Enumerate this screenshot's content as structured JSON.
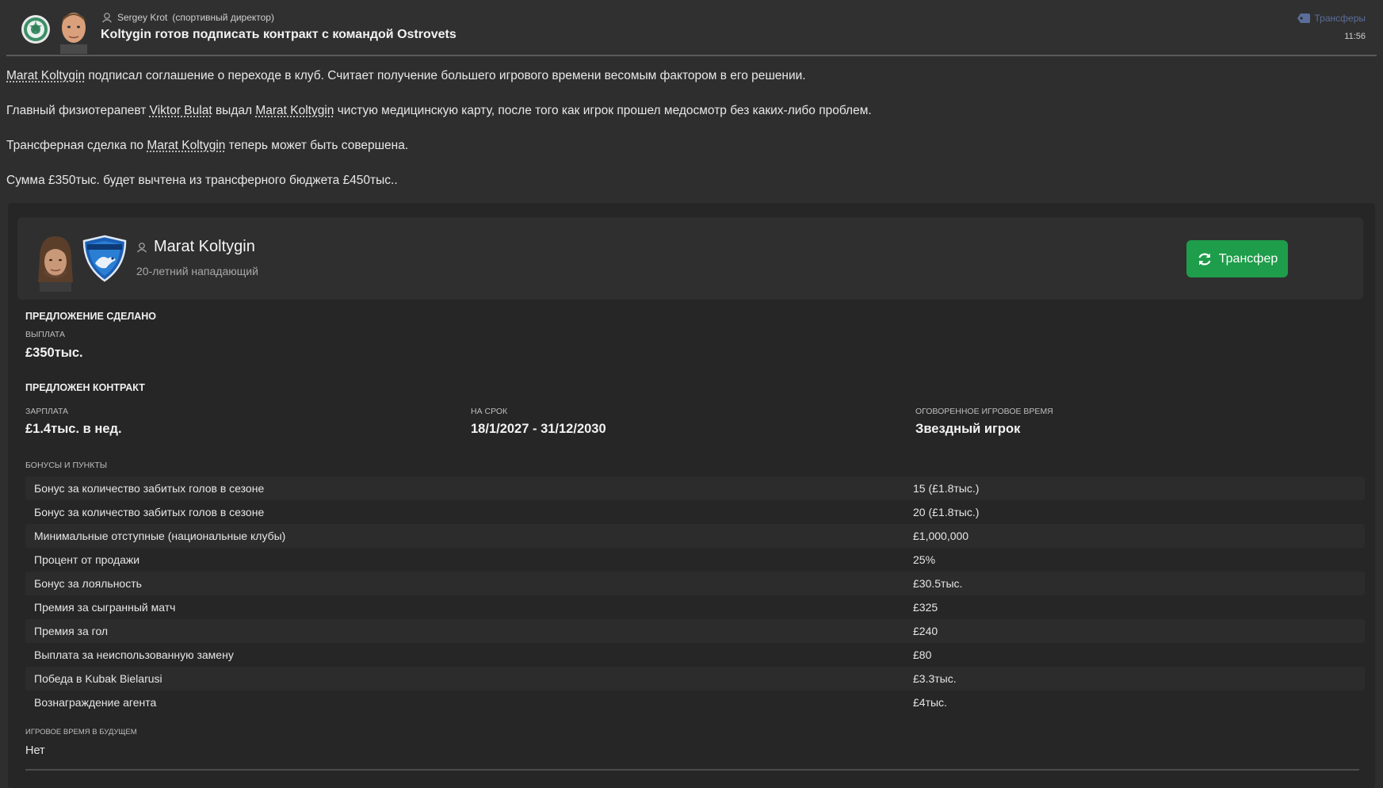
{
  "header": {
    "sender_name": "Sergey Krot",
    "sender_role": "(спортивный директор)",
    "subject": "Koltygin готов подписать контракт с командой Ostrovets",
    "category": "Трансферы",
    "time": "11:56"
  },
  "body": {
    "p1_link": "Marat Koltygin",
    "p1_rest": " подписал соглашение о переходе в клуб. Считает получение большего игрового времени весомым фактором в его решении.",
    "p2_a": "Главный физиотерапевт ",
    "p2_link1": "Viktor Bulat",
    "p2_b": " выдал ",
    "p2_link2": "Marat Koltygin",
    "p2_c": " чистую медицинскую карту, после того как игрок прошел медосмотр без каких-либо проблем.",
    "p3_a": "Трансферная сделка по ",
    "p3_link": "Marat Koltygin",
    "p3_b": " теперь может быть совершена.",
    "p4": "Сумма £350тыс. будет вычтена из трансферного бюджета £450тыс.."
  },
  "player": {
    "name": "Marat Koltygin",
    "description": "20-летний нападающий",
    "transfer_button": "Трансфер"
  },
  "offer": {
    "title": "ПРЕДЛОЖЕНИЕ СДЕЛАНО",
    "payment_label": "ВЫПЛАТА",
    "payment_value": "£350тыс."
  },
  "contract": {
    "title": "ПРЕДЛОЖЕН КОНТРАКТ",
    "wage_label": "ЗАРПЛАТА",
    "wage_value": "£1.4тыс. в нед.",
    "term_label": "НА СРОК",
    "term_value": "18/1/2027 - 31/12/2030",
    "playtime_label": "ОГОВОРЕННОЕ ИГРОВОЕ ВРЕМЯ",
    "playtime_value": "Звездный игрок",
    "bonuses_label": "БОНУСЫ И ПУНКТЫ",
    "bonuses": [
      {
        "name": "Бонус за количество забитых голов в сезоне",
        "value": "15 (£1.8тыс.)"
      },
      {
        "name": "Бонус за количество забитых голов в сезоне",
        "value": "20 (£1.8тыс.)"
      },
      {
        "name": "Минимальные отступные (национальные клубы)",
        "value": "£1,000,000"
      },
      {
        "name": "Процент от продажи",
        "value": "25%"
      },
      {
        "name": "Бонус за лояльность",
        "value": "£30.5тыс."
      },
      {
        "name": "Премия за сыгранный матч",
        "value": "£325"
      },
      {
        "name": "Премия за гол",
        "value": "£240"
      },
      {
        "name": "Выплата за неиспользованную замену",
        "value": "£80"
      },
      {
        "name": "Победа в Kubak Bielarusi",
        "value": "£3.3тыс."
      },
      {
        "name": "Вознаграждение агента",
        "value": "£4тыс."
      }
    ],
    "future_label": "ИГРОВОЕ ВРЕМЯ В БУДУЩЕМ",
    "future_value": "Нет"
  },
  "colors": {
    "background": "#2e2e2e",
    "panel": "#262626",
    "button_green": "#1e9d4a",
    "category_blue": "#5a6e9a"
  },
  "icons": {
    "club_badge": "club-badge-icon",
    "sender_photo": "sender-photo-icon",
    "person": "person-icon",
    "category": "tag-icon",
    "player_photo": "player-photo-icon",
    "player_club": "player-club-crest-icon",
    "transfer": "refresh-icon"
  }
}
